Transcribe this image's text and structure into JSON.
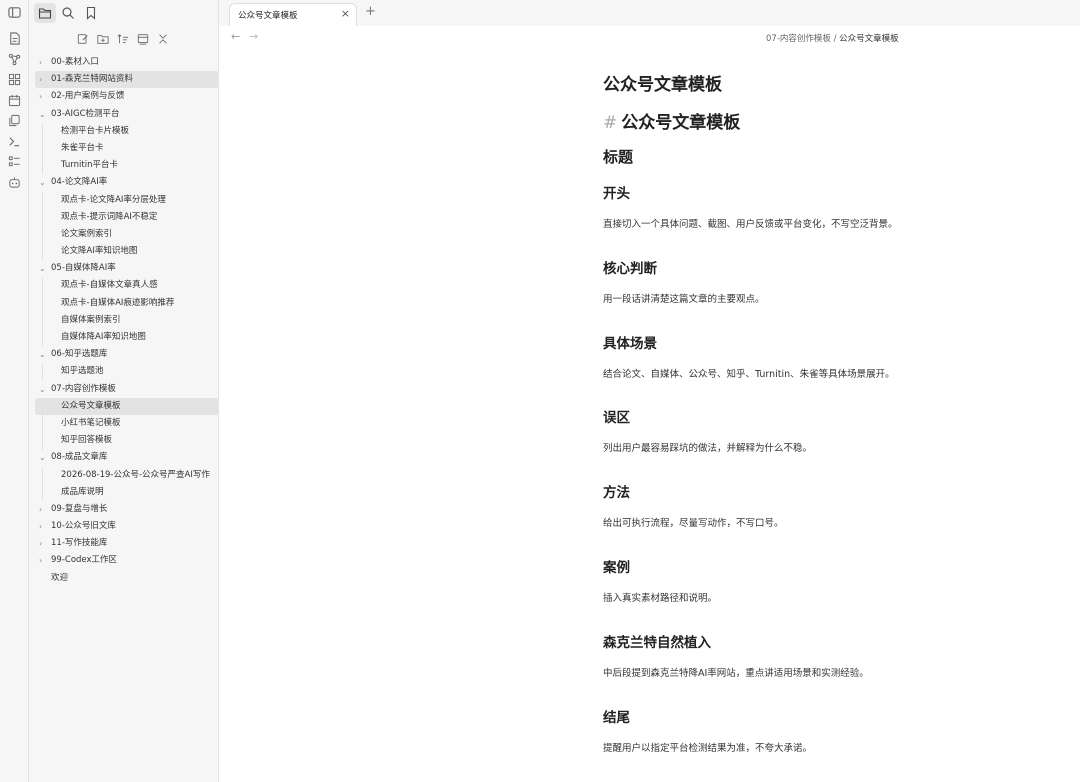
{
  "ribbon": {
    "icons": [
      "sidebar-toggle-icon",
      "file-icon",
      "graph-icon",
      "grid-icon",
      "calendar-icon",
      "copy-icon",
      "terminal-icon",
      "list-icon",
      "robot-icon"
    ]
  },
  "sidebar_top": {
    "icons": [
      "folder-icon",
      "search-icon",
      "bookmark-icon"
    ]
  },
  "sidebar_actions": {
    "icons": [
      "new-note-icon",
      "new-folder-icon",
      "sort-icon",
      "collapse-icon",
      "close-icon"
    ]
  },
  "tree": [
    {
      "label": "00-素材入口",
      "chev": "›",
      "level": 0
    },
    {
      "label": "01-森克兰特网站资料",
      "chev": "›",
      "level": 0,
      "selected": true
    },
    {
      "label": "02-用户案例与反馈",
      "chev": "›",
      "level": 0
    },
    {
      "label": "03-AIGC检测平台",
      "chev": "⌄",
      "level": 0
    },
    {
      "label": "检测平台卡片模板",
      "level": 1
    },
    {
      "label": "朱雀平台卡",
      "level": 1
    },
    {
      "label": "Turnitin平台卡",
      "level": 1
    },
    {
      "label": "04-论文降AI率",
      "chev": "⌄",
      "level": 0
    },
    {
      "label": "观点卡-论文降AI率分层处理",
      "level": 1
    },
    {
      "label": "观点卡-提示词降AI不稳定",
      "level": 1
    },
    {
      "label": "论文案例索引",
      "level": 1
    },
    {
      "label": "论文降AI率知识地图",
      "level": 1
    },
    {
      "label": "05-自媒体降AI率",
      "chev": "⌄",
      "level": 0
    },
    {
      "label": "观点卡-自媒体文章真人感",
      "level": 1
    },
    {
      "label": "观点卡-自媒体AI痕迹影响推荐",
      "level": 1
    },
    {
      "label": "自媒体案例索引",
      "level": 1
    },
    {
      "label": "自媒体降AI率知识地图",
      "level": 1
    },
    {
      "label": "06-知乎选题库",
      "chev": "⌄",
      "level": 0
    },
    {
      "label": "知乎选题池",
      "level": 1
    },
    {
      "label": "07-内容创作模板",
      "chev": "⌄",
      "level": 0
    },
    {
      "label": "公众号文章模板",
      "level": 1,
      "selected": true
    },
    {
      "label": "小红书笔记模板",
      "level": 1
    },
    {
      "label": "知乎回答模板",
      "level": 1
    },
    {
      "label": "08-成品文章库",
      "chev": "⌄",
      "level": 0
    },
    {
      "label": "2026-08-19-公众号-公众号严查AI写作",
      "level": 1
    },
    {
      "label": "成品库说明",
      "level": 1
    },
    {
      "label": "09-复盘与增长",
      "chev": "›",
      "level": 0
    },
    {
      "label": "10-公众号旧文库",
      "chev": "›",
      "level": 0
    },
    {
      "label": "11-写作技能库",
      "chev": "›",
      "level": 0
    },
    {
      "label": "99-Codex工作区",
      "chev": "›",
      "level": 0
    },
    {
      "label": "欢迎",
      "level": 0
    }
  ],
  "tab": {
    "title": "公众号文章模板",
    "close": "×",
    "new": "+"
  },
  "nav": {
    "back": "←",
    "forward": "→"
  },
  "breadcrumb": {
    "folder": "07-内容创作模板",
    "sep": " / ",
    "current": "公众号文章模板"
  },
  "doc": {
    "title": "公众号文章模板",
    "h1_hash": "#",
    "h1": "公众号文章模板",
    "h2": "标题",
    "sections": [
      {
        "heading": "开头",
        "text": "直接切入一个具体问题、截图、用户反馈或平台变化，不写空泛背景。"
      },
      {
        "heading": "核心判断",
        "text": "用一段话讲清楚这篇文章的主要观点。"
      },
      {
        "heading": "具体场景",
        "text": "结合论文、自媒体、公众号、知乎、Turnitin、朱雀等具体场景展开。"
      },
      {
        "heading": "误区",
        "text": "列出用户最容易踩坑的做法，并解释为什么不稳。"
      },
      {
        "heading": "方法",
        "text": "给出可执行流程，尽量写动作，不写口号。"
      },
      {
        "heading": "案例",
        "text": "插入真实素材路径和说明。"
      },
      {
        "heading": "森克兰特自然植入",
        "text": "中后段提到森克兰特降AI率网站，重点讲适用场景和实测经验。"
      },
      {
        "heading": "结尾",
        "text": "提醒用户以指定平台检测结果为准，不夸大承诺。"
      }
    ]
  }
}
